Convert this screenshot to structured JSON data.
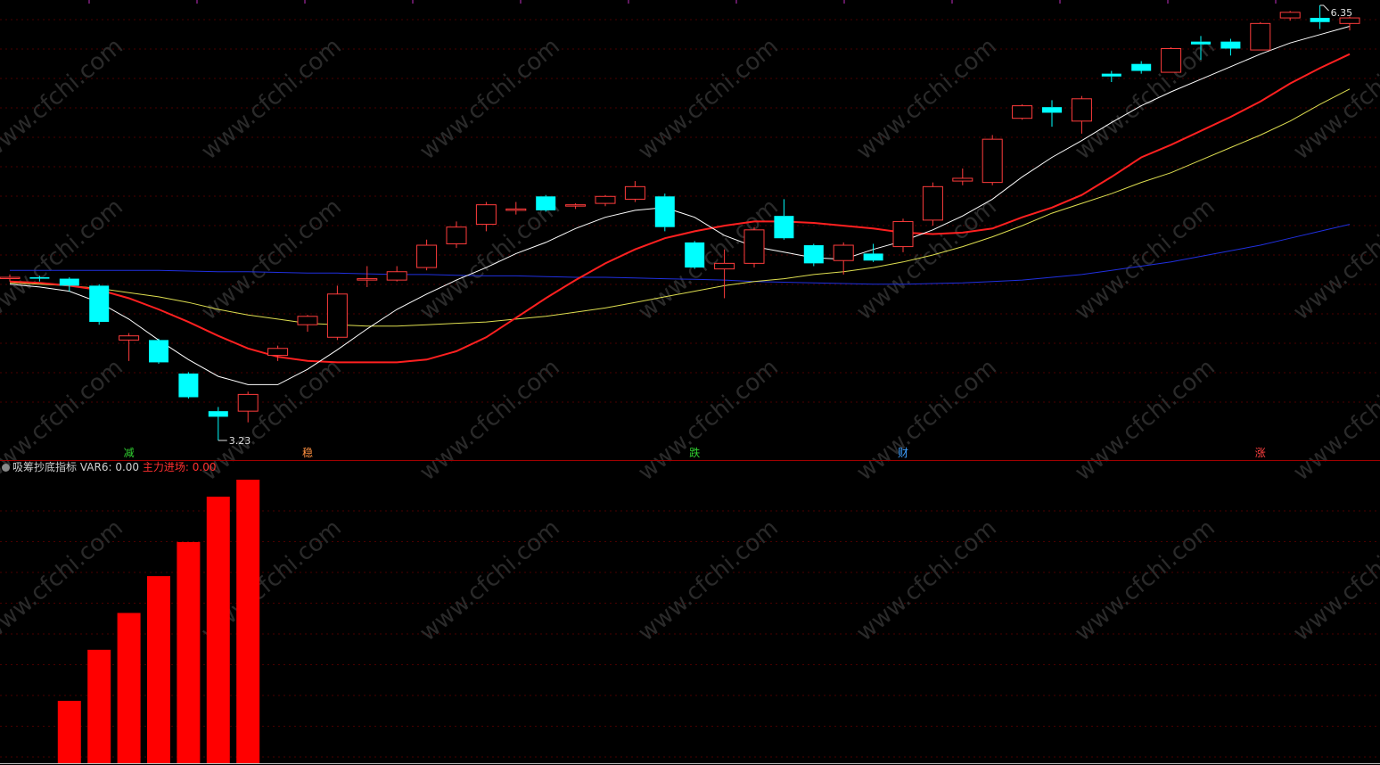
{
  "colors": {
    "background": "#000000",
    "grid": "#4a0000",
    "up": "#ff3c3c",
    "down": "#00ffff",
    "ma5": "#ffffff",
    "ma10": "#ff2020",
    "ma20": "#dede50",
    "ma60": "#2030e0",
    "bar": "#ff0000",
    "watermark": "#2a2a2a"
  },
  "watermark": "www.cfchi.com",
  "indicator": {
    "name": "吸筹抄底指标",
    "var6_label": "VAR6:",
    "var6_value": "0.00",
    "main_label": "主力进场:",
    "main_value": "0.00"
  },
  "chart_data": [
    {
      "type": "candlestick",
      "ylim": [
        3.23,
        6.35
      ],
      "annotations": {
        "high": "6.35",
        "low": "3.23"
      },
      "markers": [
        {
          "index": 4,
          "text": "减",
          "color": "#30d030"
        },
        {
          "index": 10,
          "text": "稳",
          "color": "#ff9040"
        },
        {
          "index": 23,
          "text": "跌",
          "color": "#30d030"
        },
        {
          "index": 30,
          "text": "财",
          "color": "#40a0ff"
        },
        {
          "index": 42,
          "text": "涨",
          "color": "#ff4040"
        }
      ],
      "candles": [
        {
          "o": 4.4,
          "h": 4.42,
          "l": 4.37,
          "c": 4.4
        },
        {
          "o": 4.4,
          "h": 4.41,
          "l": 4.37,
          "c": 4.39
        },
        {
          "o": 4.39,
          "h": 4.4,
          "l": 4.3,
          "c": 4.34
        },
        {
          "o": 4.34,
          "h": 4.35,
          "l": 4.06,
          "c": 4.08
        },
        {
          "o": 3.95,
          "h": 4.0,
          "l": 3.8,
          "c": 3.98
        },
        {
          "o": 3.95,
          "h": 3.96,
          "l": 3.78,
          "c": 3.79
        },
        {
          "o": 3.71,
          "h": 3.72,
          "l": 3.53,
          "c": 3.54
        },
        {
          "o": 3.44,
          "h": 3.47,
          "l": 3.23,
          "c": 3.4
        },
        {
          "o": 3.44,
          "h": 3.58,
          "l": 3.36,
          "c": 3.56
        },
        {
          "o": 3.84,
          "h": 3.91,
          "l": 3.8,
          "c": 3.89
        },
        {
          "o": 4.06,
          "h": 4.13,
          "l": 4.01,
          "c": 4.12
        },
        {
          "o": 3.97,
          "h": 4.34,
          "l": 3.95,
          "c": 4.28
        },
        {
          "o": 4.38,
          "h": 4.48,
          "l": 4.33,
          "c": 4.39
        },
        {
          "o": 4.38,
          "h": 4.48,
          "l": 4.37,
          "c": 4.44
        },
        {
          "o": 4.47,
          "h": 4.67,
          "l": 4.45,
          "c": 4.63
        },
        {
          "o": 4.64,
          "h": 4.8,
          "l": 4.61,
          "c": 4.76
        },
        {
          "o": 4.78,
          "h": 4.94,
          "l": 4.73,
          "c": 4.92
        },
        {
          "o": 4.88,
          "h": 4.94,
          "l": 4.85,
          "c": 4.89
        },
        {
          "o": 4.98,
          "h": 4.99,
          "l": 4.87,
          "c": 4.88
        },
        {
          "o": 4.92,
          "h": 4.93,
          "l": 4.89,
          "c": 4.92
        },
        {
          "o": 4.93,
          "h": 4.99,
          "l": 4.91,
          "c": 4.98
        },
        {
          "o": 4.96,
          "h": 5.09,
          "l": 4.94,
          "c": 5.05
        },
        {
          "o": 4.98,
          "h": 5.0,
          "l": 4.73,
          "c": 4.76
        },
        {
          "o": 4.65,
          "h": 4.66,
          "l": 4.46,
          "c": 4.47
        },
        {
          "o": 4.46,
          "h": 4.6,
          "l": 4.25,
          "c": 4.5
        },
        {
          "o": 4.5,
          "h": 4.76,
          "l": 4.47,
          "c": 4.74
        },
        {
          "o": 4.84,
          "h": 4.96,
          "l": 4.67,
          "c": 4.68
        },
        {
          "o": 4.63,
          "h": 4.64,
          "l": 4.48,
          "c": 4.5
        },
        {
          "o": 4.52,
          "h": 4.65,
          "l": 4.42,
          "c": 4.63
        },
        {
          "o": 4.57,
          "h": 4.64,
          "l": 4.51,
          "c": 4.52
        },
        {
          "o": 4.62,
          "h": 4.82,
          "l": 4.58,
          "c": 4.8
        },
        {
          "o": 4.81,
          "h": 5.08,
          "l": 4.77,
          "c": 5.05
        },
        {
          "o": 5.09,
          "h": 5.18,
          "l": 5.06,
          "c": 5.11
        },
        {
          "o": 5.08,
          "h": 5.42,
          "l": 5.06,
          "c": 5.39
        },
        {
          "o": 5.54,
          "h": 5.64,
          "l": 5.53,
          "c": 5.63
        },
        {
          "o": 5.62,
          "h": 5.67,
          "l": 5.48,
          "c": 5.58
        },
        {
          "o": 5.52,
          "h": 5.7,
          "l": 5.43,
          "c": 5.68
        },
        {
          "o": 5.86,
          "h": 5.88,
          "l": 5.8,
          "c": 5.84
        },
        {
          "o": 5.93,
          "h": 5.95,
          "l": 5.86,
          "c": 5.88
        },
        {
          "o": 5.87,
          "h": 6.05,
          "l": 5.87,
          "c": 6.04
        },
        {
          "o": 6.09,
          "h": 6.13,
          "l": 5.96,
          "c": 6.07
        },
        {
          "o": 6.09,
          "h": 6.11,
          "l": 5.99,
          "c": 6.04
        },
        {
          "o": 6.03,
          "h": 6.23,
          "l": 6.03,
          "c": 6.22
        },
        {
          "o": 6.26,
          "h": 6.31,
          "l": 6.24,
          "c": 6.3
        },
        {
          "o": 6.26,
          "h": 6.35,
          "l": 6.18,
          "c": 6.23
        },
        {
          "o": 6.22,
          "h": 6.27,
          "l": 6.17,
          "c": 6.26
        }
      ],
      "ma5": [
        4.35,
        4.33,
        4.3,
        4.22,
        4.1,
        3.95,
        3.81,
        3.69,
        3.63,
        3.63,
        3.74,
        3.88,
        4.03,
        4.17,
        4.28,
        4.38,
        4.47,
        4.57,
        4.65,
        4.75,
        4.83,
        4.88,
        4.9,
        4.83,
        4.7,
        4.62,
        4.58,
        4.54,
        4.53,
        4.6,
        4.66,
        4.74,
        4.84,
        4.96,
        5.12,
        5.26,
        5.38,
        5.51,
        5.63,
        5.73,
        5.82,
        5.91,
        6.0,
        6.08,
        6.14,
        6.2
      ],
      "ma10": [
        4.37,
        4.36,
        4.34,
        4.31,
        4.25,
        4.17,
        4.08,
        3.98,
        3.89,
        3.83,
        3.8,
        3.79,
        3.79,
        3.79,
        3.81,
        3.87,
        3.97,
        4.11,
        4.25,
        4.38,
        4.5,
        4.6,
        4.68,
        4.73,
        4.77,
        4.8,
        4.8,
        4.79,
        4.77,
        4.75,
        4.72,
        4.71,
        4.72,
        4.75,
        4.83,
        4.9,
        4.99,
        5.12,
        5.26,
        5.35,
        5.45,
        5.55,
        5.66,
        5.79,
        5.9,
        6.0
      ],
      "ma20": [
        4.36,
        4.35,
        4.34,
        4.32,
        4.29,
        4.26,
        4.22,
        4.17,
        4.13,
        4.1,
        4.07,
        4.06,
        4.05,
        4.05,
        4.06,
        4.07,
        4.08,
        4.1,
        4.12,
        4.15,
        4.18,
        4.22,
        4.26,
        4.3,
        4.34,
        4.37,
        4.39,
        4.42,
        4.44,
        4.47,
        4.51,
        4.56,
        4.62,
        4.69,
        4.77,
        4.86,
        4.93,
        5.0,
        5.08,
        5.15,
        5.24,
        5.33,
        5.42,
        5.52,
        5.64,
        5.75
      ],
      "ma60": [
        4.45,
        4.45,
        4.45,
        4.45,
        4.45,
        4.45,
        4.445,
        4.44,
        4.44,
        4.435,
        4.43,
        4.43,
        4.425,
        4.42,
        4.42,
        4.415,
        4.41,
        4.41,
        4.405,
        4.4,
        4.4,
        4.395,
        4.39,
        4.385,
        4.38,
        4.37,
        4.365,
        4.36,
        4.355,
        4.35,
        4.35,
        4.355,
        4.36,
        4.37,
        4.38,
        4.4,
        4.42,
        4.45,
        4.48,
        4.51,
        4.55,
        4.59,
        4.63,
        4.68,
        4.73,
        4.78
      ]
    },
    {
      "type": "bar",
      "name": "主力进场",
      "ylim": [
        0,
        100
      ],
      "values": [
        0,
        0,
        22,
        40,
        53,
        66,
        78,
        94,
        100,
        0,
        0,
        0,
        0,
        0,
        0,
        0,
        0,
        0,
        0,
        0,
        0,
        0,
        0,
        0,
        0,
        0,
        0,
        0,
        0,
        0,
        0,
        0,
        0,
        0,
        0,
        0,
        0,
        0,
        0,
        0,
        0,
        0,
        0,
        0,
        0,
        0
      ]
    }
  ]
}
